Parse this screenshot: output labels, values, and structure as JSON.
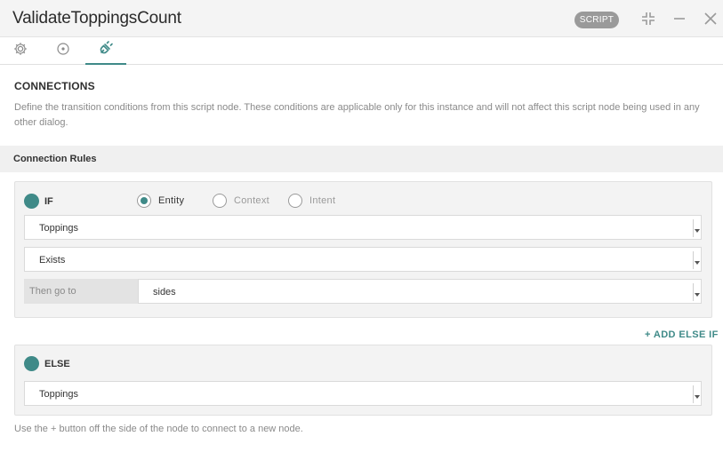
{
  "window": {
    "title": "ValidateToppingsCount",
    "badge": "SCRIPT",
    "icons": [
      "collapse-icon",
      "minimize-icon",
      "close-icon"
    ]
  },
  "tabs": [
    {
      "icon": "gear-icon",
      "active": false
    },
    {
      "icon": "target-icon",
      "active": false
    },
    {
      "icon": "plug-icon",
      "active": true
    }
  ],
  "connections": {
    "title": "CONNECTIONS",
    "description": "Define the transition conditions from this script node. These conditions are applicable only for this instance and will not affect this script node being used in any other dialog."
  },
  "rules": {
    "header": "Connection Rules",
    "if_block": {
      "label": "IF",
      "radio_options": [
        {
          "label": "Entity",
          "selected": true
        },
        {
          "label": "Context",
          "selected": false
        },
        {
          "label": "Intent",
          "selected": false
        }
      ],
      "entity_select": "Toppings",
      "condition_select": "Exists",
      "goto_label": "Then go to",
      "goto_select": "sides"
    },
    "add_else_if": "+ ADD ELSE IF",
    "else_block": {
      "label": "ELSE",
      "select": "Toppings"
    },
    "footer_note": "Use the + button off the side of the node to connect to a new node."
  },
  "colors": {
    "accent": "#3f8a88",
    "badge_bg": "#9a9a9a",
    "card_bg": "#f3f3f3"
  }
}
